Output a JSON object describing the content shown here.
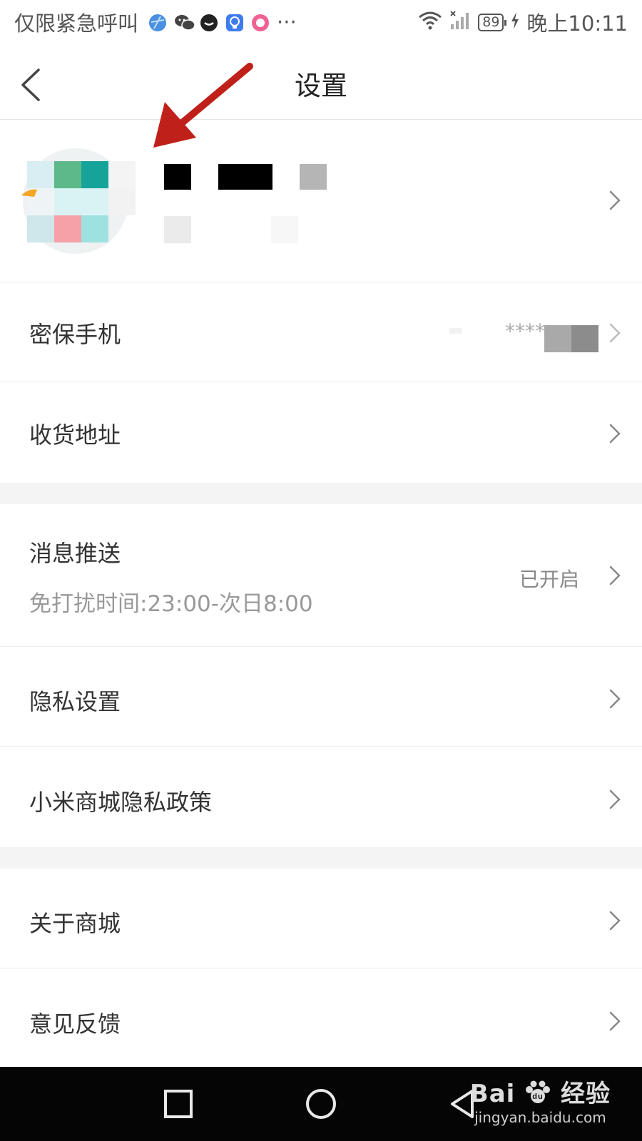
{
  "status_bar": {
    "carrier_text": "仅限紧急呼叫",
    "more_dots": "···",
    "battery": "89",
    "time": "晚上10:11",
    "app_icons": [
      "browser-icon",
      "wechat-icon",
      "message-icon",
      "bulb-app-icon",
      "pink-app-icon"
    ]
  },
  "header": {
    "title": "设置",
    "back_icon": "chevron-left-icon"
  },
  "profile": {
    "avatar_icon": "avatar-icon",
    "name_masked": true
  },
  "sections": [
    {
      "rows": [
        {
          "id": "security-phone",
          "label": "密保手机",
          "value": "****"
        },
        {
          "id": "shipping-address",
          "label": "收货地址"
        }
      ]
    },
    {
      "rows": [
        {
          "id": "message-push",
          "label": "消息推送",
          "sublabel": "免打扰时间:23:00-次日8:00",
          "value": "已开启"
        },
        {
          "id": "privacy-settings",
          "label": "隐私设置"
        },
        {
          "id": "privacy-policy",
          "label": "小米商城隐私政策"
        }
      ]
    },
    {
      "rows": [
        {
          "id": "about",
          "label": "关于商城"
        },
        {
          "id": "feedback",
          "label": "意见反馈"
        }
      ]
    }
  ],
  "watermark": {
    "brand": "Bai",
    "brand_cn": "经验",
    "url": "jingyan.baidu.com"
  },
  "colors": {
    "accent_arrow": "#c0201a",
    "background": "#ffffff",
    "section_gap": "#f4f4f4",
    "nav_bar": "#050505"
  }
}
